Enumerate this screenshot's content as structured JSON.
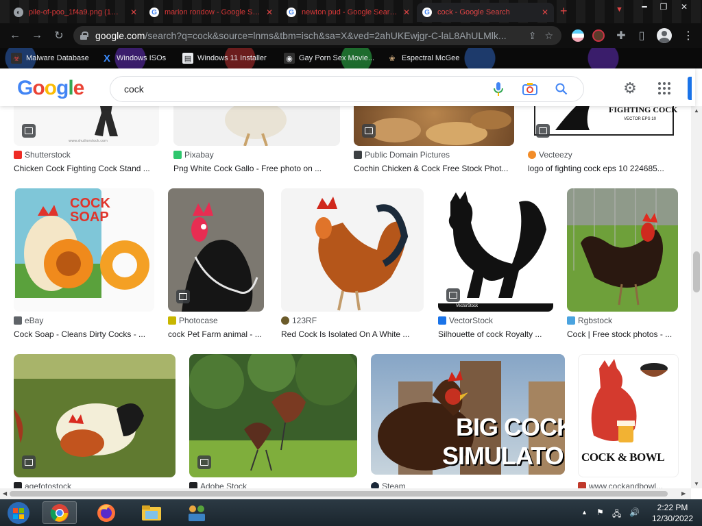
{
  "browser": {
    "tabs": [
      {
        "title": "pile-of-poo_1f4a9.png (1…",
        "icon": "image-file-icon",
        "active": false
      },
      {
        "title": "marion rondow - Google S…",
        "icon": "google-icon",
        "active": false
      },
      {
        "title": "newton pud - Google Sear…",
        "icon": "google-icon",
        "active": false
      },
      {
        "title": "cock - Google Search",
        "icon": "google-icon",
        "active": true
      }
    ],
    "new_tab": "+",
    "url_host": "google.com",
    "url_rest": "/search?q=cock&source=lnms&tbm=isch&sa=X&ved=2ahUKEwjgr-C-laL8AhULMlk...",
    "bookmarks": [
      {
        "label": "Malware Database",
        "icon": "malware-icon"
      },
      {
        "label": "Windows ISOs",
        "icon": "x-icon"
      },
      {
        "label": "Windows 11 Installer",
        "icon": "installer-icon"
      },
      {
        "label": "Gay Porn Sex Movie...",
        "icon": "bookmark-site-icon"
      },
      {
        "label": "Espectral McGee",
        "icon": "bookmark-site-icon"
      }
    ]
  },
  "google": {
    "logo": [
      "G",
      "o",
      "o",
      "g",
      "l",
      "e"
    ],
    "search_value": "cock"
  },
  "results": [
    {
      "source": "Shutterstock",
      "caption": "Chicken Cock Fighting Cock Stand ...",
      "fav_color": "#ee2b24"
    },
    {
      "source": "Pixabay",
      "caption": "Png White Cock Gallo - Free photo on ...",
      "fav_color": "#2ec66d"
    },
    {
      "source": "Public Domain Pictures",
      "caption": "Cochin Chicken & Cock Free Stock Phot...",
      "fav_color": "#3c4043"
    },
    {
      "source": "Vecteezy",
      "caption": "logo of fighting cock eps 10 224685...",
      "fav_color": "#f28c28"
    },
    {
      "source": "eBay",
      "caption": "Cock Soap - Cleans Dirty Cocks - ...",
      "fav_color": "#5f6368"
    },
    {
      "source": "Photocase",
      "caption": "cock Pet Farm animal - ...",
      "fav_color": "#c8b600"
    },
    {
      "source": "123RF",
      "caption": "Red Cock Is Isolated On A White ...",
      "fav_color": "#6b5b2a"
    },
    {
      "source": "VectorStock",
      "caption": "Silhouette of cock Royalty ...",
      "fav_color": "#1a73e8"
    },
    {
      "source": "Rgbstock",
      "caption": "Cock | Free stock photos - ...",
      "fav_color": "#4aa3df"
    },
    {
      "source": "agefotostock",
      "caption": "",
      "fav_color": "#202124"
    },
    {
      "source": "Adobe Stock",
      "caption": "",
      "fav_color": "#202124"
    },
    {
      "source": "Steam",
      "caption": "",
      "fav_color": "#1b2838"
    },
    {
      "source": "www.cockandbowl...",
      "caption": "",
      "fav_color": "#c0392b"
    }
  ],
  "thumb_text": {
    "vecteezy_logo": "FIGHTING COCK",
    "vecteezy_sub": "VECTOR EPS 10",
    "ebay_product_1": "COCK",
    "ebay_product_2": "SOAP",
    "steam_line1": "BIG COCK",
    "steam_line2": "SIMULATOR",
    "bowl_text": "COCK & BOWL",
    "vectorstock_mark": "VectorStock"
  },
  "taskbar": {
    "time": "2:22 PM",
    "date": "12/30/2022"
  }
}
